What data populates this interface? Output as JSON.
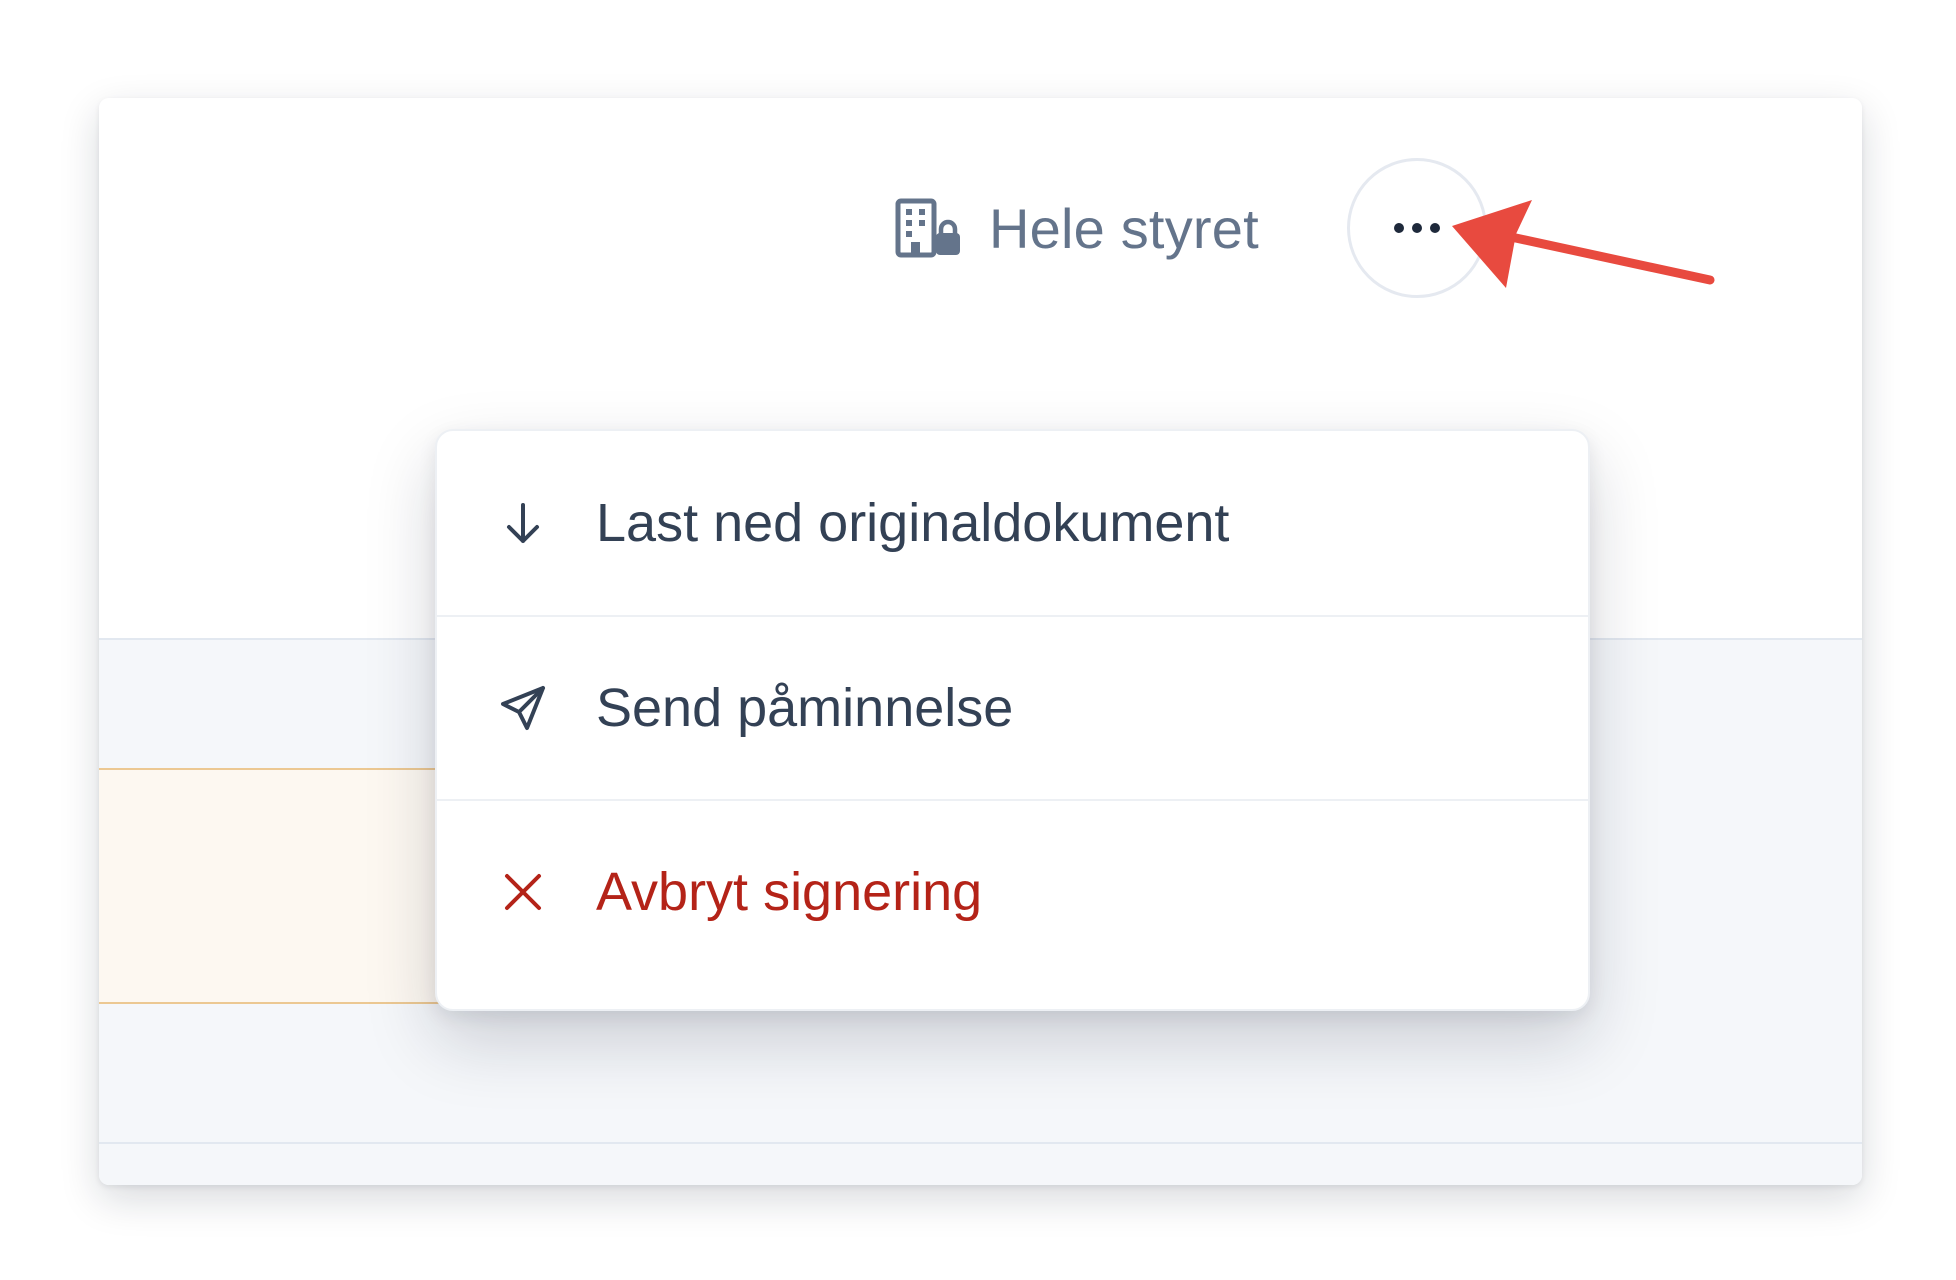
{
  "header": {
    "access_label": "Hele styret",
    "access_icon": "building-lock-icon",
    "more_icon": "more-horizontal-icon"
  },
  "menu": {
    "items": [
      {
        "label": "Last ned originaldokument",
        "icon": "arrow-down-icon",
        "variant": "default"
      },
      {
        "label": "Send påminnelse",
        "icon": "send-icon",
        "variant": "default"
      },
      {
        "label": "Avbryt signering",
        "icon": "close-icon",
        "variant": "danger"
      }
    ]
  },
  "colors": {
    "text_default": "#334155",
    "text_muted": "#64748b",
    "danger": "#b42318",
    "annotation": "#e84a3f",
    "warning_border": "#ecc892",
    "warning_button": "#d8b896",
    "body_background": "#f5f7fa"
  }
}
